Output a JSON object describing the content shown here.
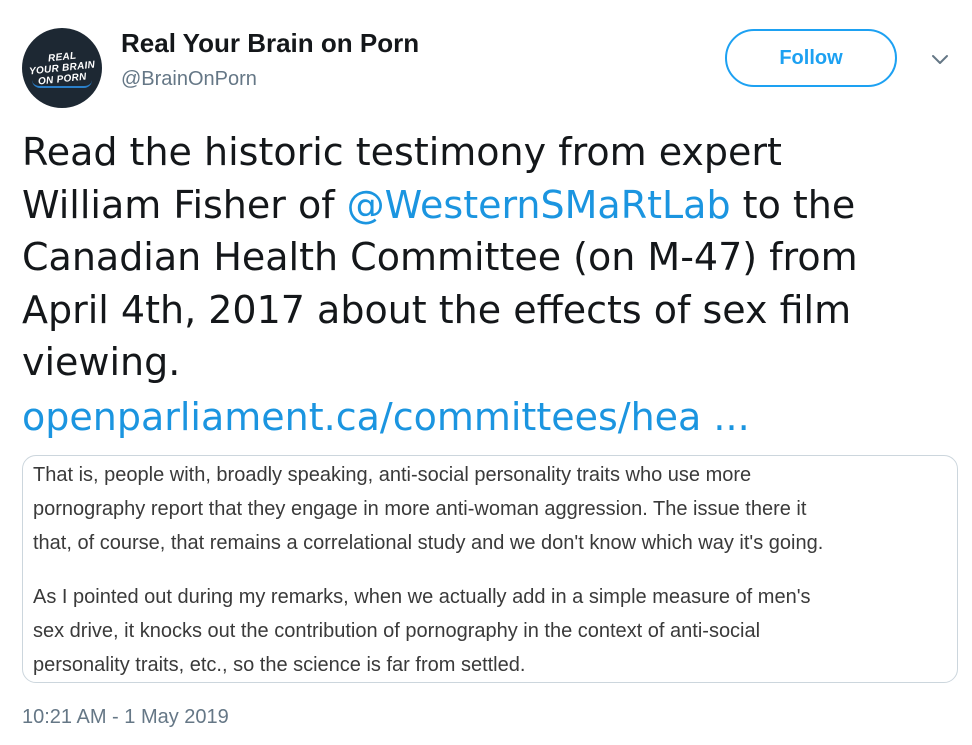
{
  "author": {
    "display_name": "Real Your Brain on Porn",
    "handle": "@BrainOnPorn",
    "avatar_text": [
      "REAL",
      "YOUR BRAIN",
      "ON PORN"
    ]
  },
  "actions": {
    "follow_label": "Follow",
    "caret_icon": "chevron-down-icon"
  },
  "tweet": {
    "lines": [
      "Read the historic testimony from expert",
      "William Fisher of ",
      " to the",
      "Canadian Health Committee (on M-47) from",
      "April 4th, 2017 about the effects of sex film",
      "viewing."
    ],
    "mention": "@WesternSMaRtLab",
    "link": "openparliament.ca/committees/hea ..."
  },
  "media": {
    "paragraph1": [
      "That is, people with, broadly speaking, anti-social personality traits who use more",
      "pornography report that they engage in more anti-woman aggression. The issue there it",
      "that, of course, that remains a correlational study and we don't know which way it's going."
    ],
    "paragraph2": [
      "As I pointed out during my remarks, when we actually add in a simple measure of men's",
      "sex drive, it knocks out the contribution of pornography in the context of anti-social",
      "personality traits, etc., so the science is far from settled."
    ]
  },
  "timestamp": "10:21 AM - 1 May 2019",
  "colors": {
    "link": "#1b95e0",
    "follow_border": "#1da1f2",
    "secondary_text": "#657786",
    "avatar_bg": "#1d2833"
  }
}
